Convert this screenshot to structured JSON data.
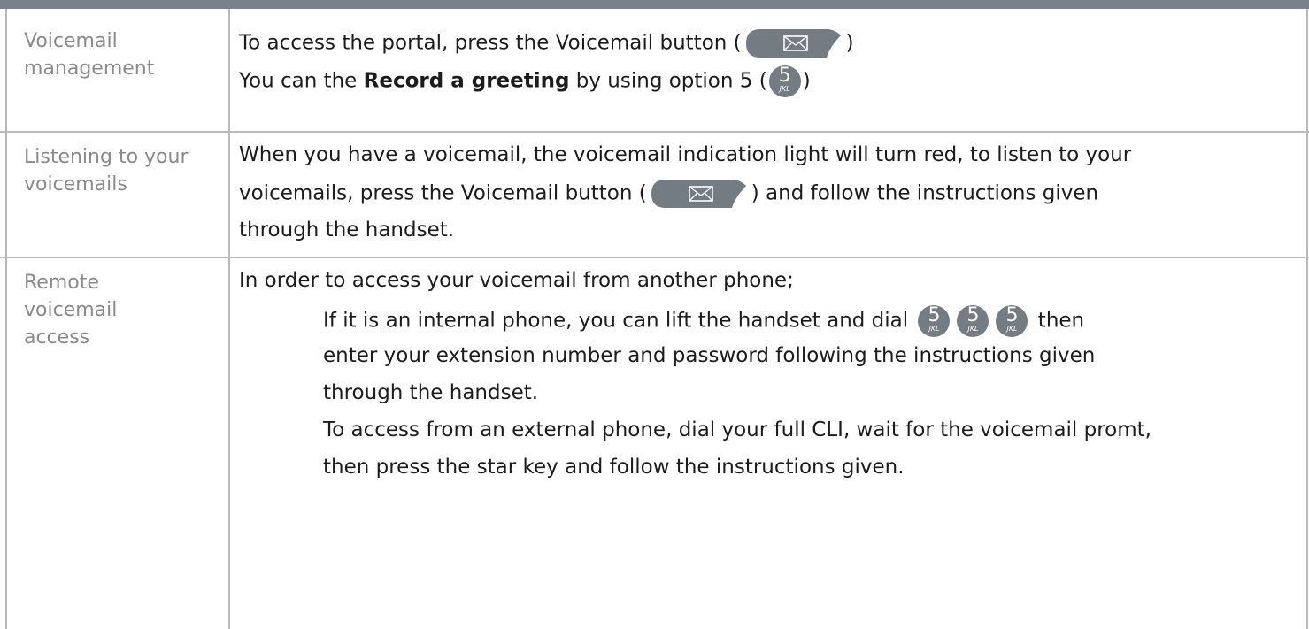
{
  "rows": [
    {
      "label_lines": [
        "Voicemail",
        "management"
      ],
      "lines": {
        "l1_pre": "To access the portal, press the Voicemail button (",
        "l1_post": ")",
        "l2_pre": "You can the ",
        "l2_bold": "Record a greeting",
        "l2_mid": " by using option 5 (",
        "l2_post": ")"
      }
    },
    {
      "label_lines": [
        "Listening to your",
        "voicemails"
      ],
      "lines": {
        "l1": "When you have a voicemail, the voicemail indication light will turn red, to listen to your",
        "l2_pre": "voicemails, press the Voicemail button (",
        "l2_post": ") and follow the instructions given",
        "l3": "through the handset."
      }
    },
    {
      "label_lines": [
        "Remote",
        "voicemail",
        "access"
      ],
      "lines": {
        "l1": "In order to access your voicemail from another phone;",
        "l2_pre": "If it is an internal phone, you can lift the handset and dial",
        "l2_post": "then",
        "l3": "enter your extension number and password following the instructions given",
        "l4": "through the handset.",
        "l5": "To access from an external phone, dial your full CLI, wait for the voicemail promt,",
        "l6": "then press the star key and follow the instructions given."
      }
    }
  ],
  "key": {
    "number": "5",
    "letters": "JKL"
  },
  "icons": {
    "voicemail_button": "envelope-icon"
  },
  "colors": {
    "border": "#b9b9b9",
    "label": "#8a8a8a",
    "button": "#737b83",
    "topbar": "#79818a"
  }
}
